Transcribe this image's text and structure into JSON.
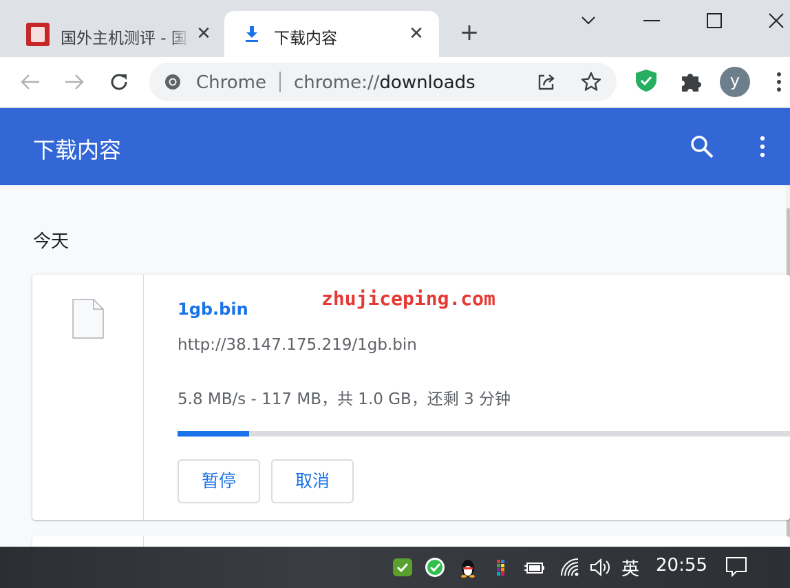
{
  "browser": {
    "tabs": [
      {
        "title": "国外主机测评 - 国",
        "close_glyph": "✕",
        "icon": "site-favicon",
        "active": false
      },
      {
        "title": "下载内容",
        "close_glyph": "✕",
        "icon": "download-icon",
        "active": true
      }
    ],
    "new_tab_glyph": "+",
    "omnibox": {
      "site_label": "Chrome",
      "url_scheme": "chrome://",
      "url_path": "downloads"
    },
    "avatar_letter": "y",
    "colors": {
      "tab_strip": "#dee1e6",
      "omnibox": "#f1f3f4",
      "extension_shield": "#27ae60",
      "avatar": "#6c7f8b"
    }
  },
  "page": {
    "title": "下载内容",
    "header_color": "#3367d6",
    "date_group": "今天",
    "download": {
      "file_name": "1gb.bin",
      "watermark": "zhujiceping.com",
      "url": "http://38.147.175.219/1gb.bin",
      "status": "5.8 MB/s - 117 MB，共 1.0 GB，还剩 3 分钟",
      "progress_fraction": 0.117,
      "pause_label": "暂停",
      "cancel_label": "取消"
    }
  },
  "taskbar": {
    "ime_label": "英",
    "clock": "20:55",
    "tray_icons": [
      "security-shield-icon",
      "check-circle-icon",
      "qq-penguin-icon",
      "colorful-app-icon",
      "power-plug-icon",
      "wifi-icon",
      "volume-icon",
      "notification-icon"
    ]
  }
}
